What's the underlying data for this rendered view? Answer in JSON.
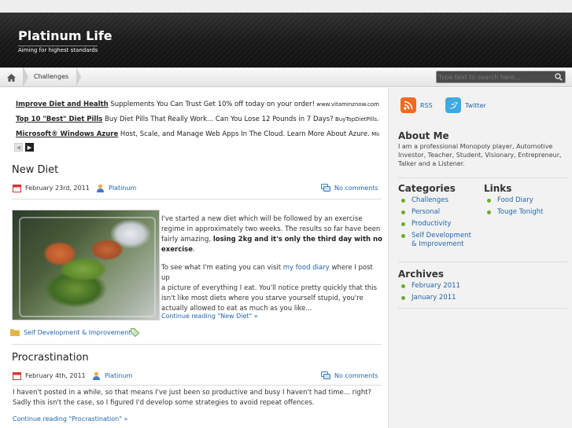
{
  "header": {
    "title": "Platinum Life",
    "tagline": "Aiming for highest standards"
  },
  "nav": {
    "items": [
      "Challenges"
    ],
    "search_placeholder": "Type text to search here..."
  },
  "ads": [
    {
      "link": "Improve Diet and Health",
      "text": " Supplements You Can Trust Get 10% off today on your order!",
      "url": " www.vitaminznow.com/"
    },
    {
      "link": "Top 10 \"Best\" Diet Pills",
      "text": " Buy Diet Pills That Really Work... Can You Lose 12 Pounds in 7 Days?",
      "url": " BuyTopDietPills.co"
    },
    {
      "link": "Microsoft® Windows Azure",
      "text": " Host, Scale, and Manage Web Apps In The Cloud. Learn More About Azure.",
      "url": " Microso"
    }
  ],
  "posts": [
    {
      "title": "New Diet",
      "date": "February 23rd, 2011",
      "author": "Platinum",
      "comments": "No comments",
      "p1_a": "I've started a new diet which will be followed by an exercise",
      "p1_b": "regime in approximately two weeks. The results so far have been",
      "p1_c": "fairly amazing, ",
      "p1_bold1": "losing 2kg and it's only the third day with no",
      "p1_bold2": "exercise",
      "p1_end": ".",
      "p2_a": "To see what I'm eating you can visit ",
      "p2_link": "my food diary",
      "p2_b": " where I post up",
      "p2_c": "a picture of everything I eat. You'll notice pretty quickly that this",
      "p2_d": "isn't like most diets where you starve yourself stupid, you're",
      "p2_e": "actually allowed to eat as much as you like...",
      "continue": "Continue reading \"New Diet\" »",
      "category": "Self Development & Improvement"
    },
    {
      "title": "Procrastination",
      "date": "February 4th, 2011",
      "author": "Platinum",
      "comments": "No comments",
      "p1_a": "I haven't posted in a while, so that means I've just been so productive and busy I haven't had time... right?",
      "p1_b": "Sadly this isn't the case, so I figured I'd develop some strategies to avoid repeat offences.",
      "continue": "Continue reading \"Procrastination\" »"
    }
  ],
  "sidebar": {
    "rss": "RSS",
    "twitter": "Twitter",
    "about_title": "About Me",
    "about_text1": "I am a professional Monopoly player, Automotive",
    "about_text2": "Investor, Teacher, Student, Visionary, Entrepreneur,",
    "about_text3": "Talker and a Listener.",
    "categories_title": "Categories",
    "categories": [
      "Challenges",
      "Personal",
      "Productivity",
      "Self Development & Improvement"
    ],
    "links_title": "Links",
    "links": [
      "Food Diary",
      "Touge Tonight"
    ],
    "archives_title": "Archives",
    "archives": [
      "February 2011",
      "January 2011"
    ]
  },
  "colors": {
    "accent": "#2266aa",
    "bullet": "#6aac2a",
    "rss": "#f26a21",
    "twitter": "#3fa9e0"
  }
}
